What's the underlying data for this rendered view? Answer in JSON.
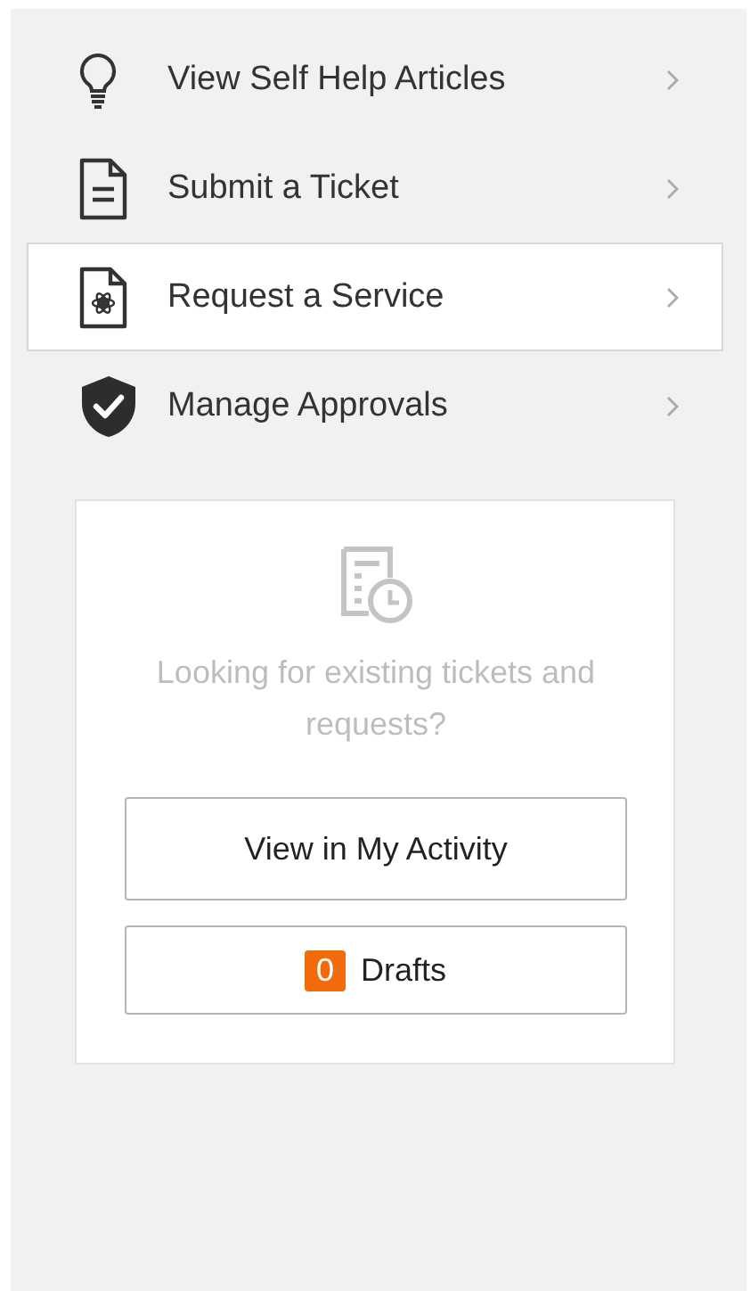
{
  "menu": [
    {
      "kind": "bulb",
      "label": "View Self Help Articles",
      "selected": false
    },
    {
      "kind": "document",
      "label": "Submit a Ticket",
      "selected": false
    },
    {
      "kind": "service",
      "label": "Request a Service",
      "selected": true
    },
    {
      "kind": "shield",
      "label": "Manage Approvals",
      "selected": false
    }
  ],
  "activity_card": {
    "message": "Looking for existing tickets and requests?",
    "buttons": [
      {
        "kind": "plain",
        "label": "View in My Activity"
      },
      {
        "kind": "drafts",
        "count": "0",
        "label": "Drafts"
      }
    ]
  }
}
